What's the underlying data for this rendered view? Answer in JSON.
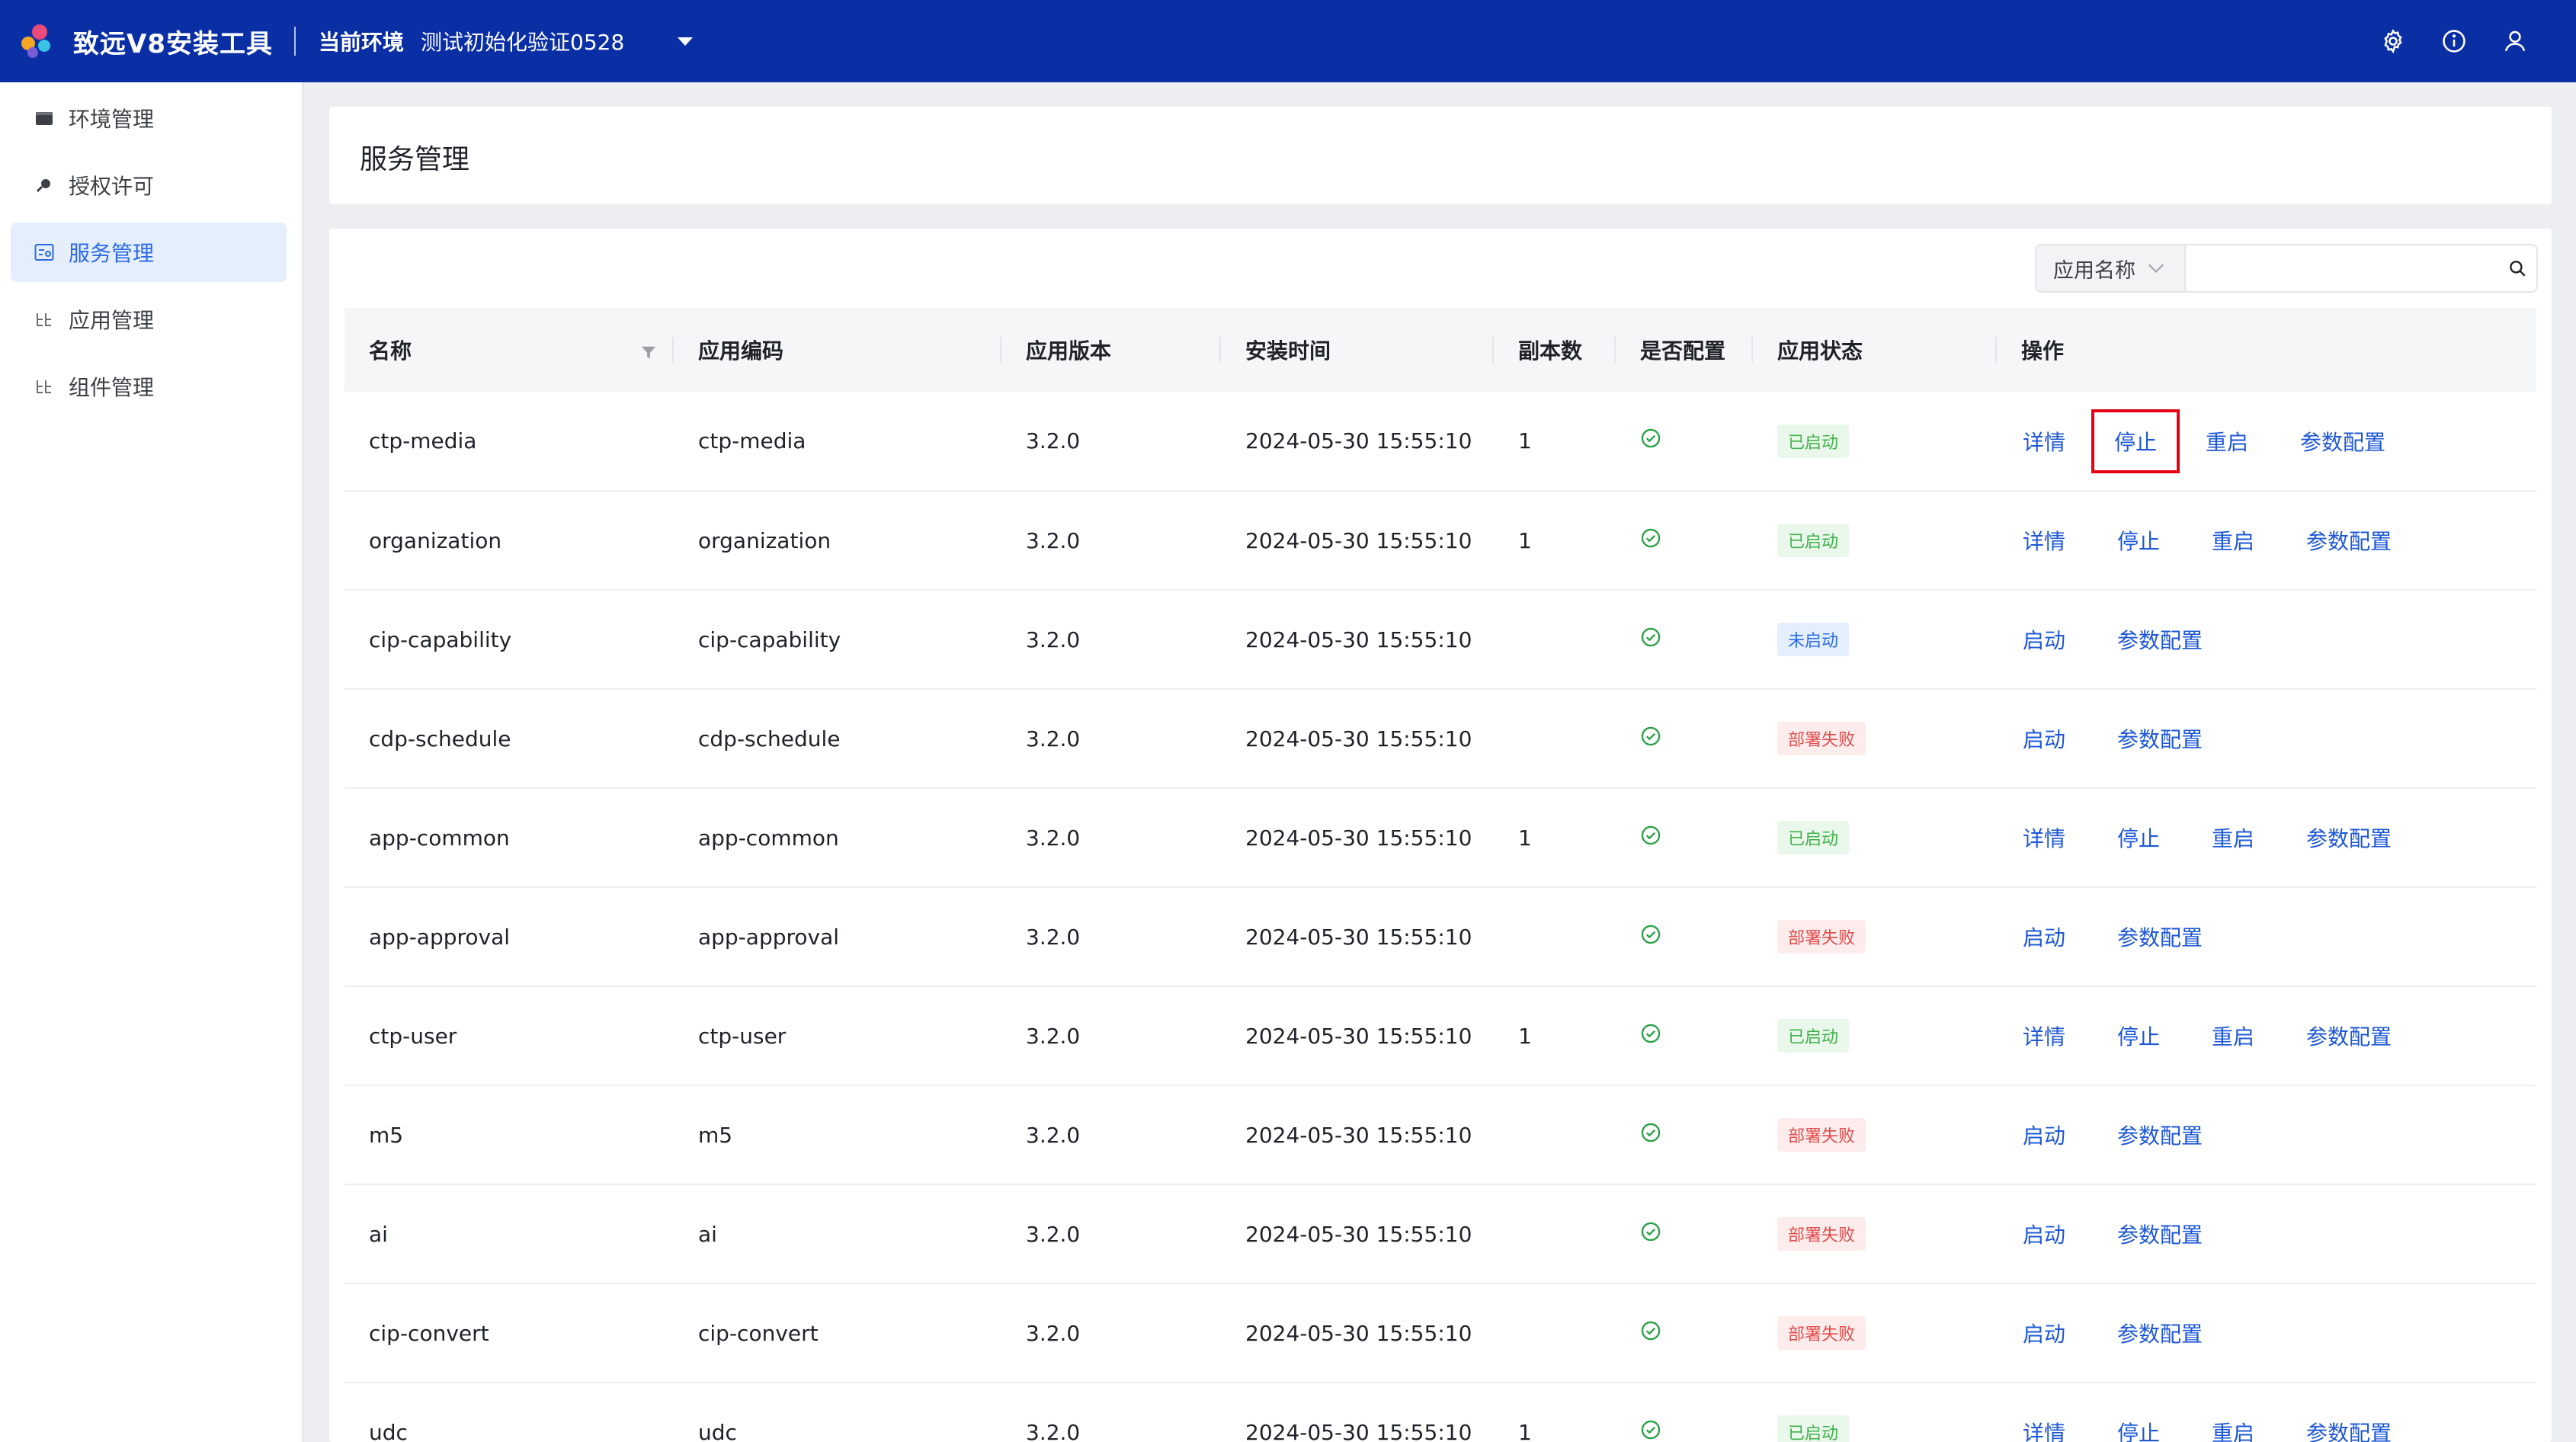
{
  "header": {
    "app_title": "致远V8安装工具",
    "env_label": "当前环境",
    "env_value": "测试初始化验证0528",
    "icons": [
      "gear-icon",
      "info-icon",
      "user-icon"
    ]
  },
  "sidebar": {
    "items": [
      {
        "label": "环境管理",
        "icon": "folder-icon",
        "active": false
      },
      {
        "label": "授权许可",
        "icon": "key-icon",
        "active": false
      },
      {
        "label": "服务管理",
        "icon": "service-icon",
        "active": true
      },
      {
        "label": "应用管理",
        "icon": "grid-icon",
        "active": false
      },
      {
        "label": "组件管理",
        "icon": "grid-icon",
        "active": false
      }
    ]
  },
  "page": {
    "title": "服务管理"
  },
  "search": {
    "select_label": "应用名称",
    "placeholder": ""
  },
  "table": {
    "columns": [
      "名称",
      "应用编码",
      "应用版本",
      "安装时间",
      "副本数",
      "是否配置",
      "应用状态",
      "操作"
    ],
    "rows": [
      {
        "name": "ctp-media",
        "code": "ctp-media",
        "version": "3.2.0",
        "time": "2024-05-30 15:55:10",
        "replicas": "1",
        "status": "已启动",
        "status_type": "started",
        "actions": [
          "详情",
          "停止",
          "重启",
          "参数配置"
        ]
      },
      {
        "name": "organization",
        "code": "organization",
        "version": "3.2.0",
        "time": "2024-05-30 15:55:10",
        "replicas": "1",
        "status": "已启动",
        "status_type": "started",
        "actions": [
          "详情",
          "停止",
          "重启",
          "参数配置"
        ]
      },
      {
        "name": "cip-capability",
        "code": "cip-capability",
        "version": "3.2.0",
        "time": "2024-05-30 15:55:10",
        "replicas": "",
        "status": "未启动",
        "status_type": "stopped",
        "actions": [
          "启动",
          "参数配置"
        ]
      },
      {
        "name": "cdp-schedule",
        "code": "cdp-schedule",
        "version": "3.2.0",
        "time": "2024-05-30 15:55:10",
        "replicas": "",
        "status": "部署失败",
        "status_type": "failed",
        "actions": [
          "启动",
          "参数配置"
        ]
      },
      {
        "name": "app-common",
        "code": "app-common",
        "version": "3.2.0",
        "time": "2024-05-30 15:55:10",
        "replicas": "1",
        "status": "已启动",
        "status_type": "started",
        "actions": [
          "详情",
          "停止",
          "重启",
          "参数配置"
        ]
      },
      {
        "name": "app-approval",
        "code": "app-approval",
        "version": "3.2.0",
        "time": "2024-05-30 15:55:10",
        "replicas": "",
        "status": "部署失败",
        "status_type": "failed",
        "actions": [
          "启动",
          "参数配置"
        ]
      },
      {
        "name": "ctp-user",
        "code": "ctp-user",
        "version": "3.2.0",
        "time": "2024-05-30 15:55:10",
        "replicas": "1",
        "status": "已启动",
        "status_type": "started",
        "actions": [
          "详情",
          "停止",
          "重启",
          "参数配置"
        ]
      },
      {
        "name": "m5",
        "code": "m5",
        "version": "3.2.0",
        "time": "2024-05-30 15:55:10",
        "replicas": "",
        "status": "部署失败",
        "status_type": "failed",
        "actions": [
          "启动",
          "参数配置"
        ]
      },
      {
        "name": "ai",
        "code": "ai",
        "version": "3.2.0",
        "time": "2024-05-30 15:55:10",
        "replicas": "",
        "status": "部署失败",
        "status_type": "failed",
        "actions": [
          "启动",
          "参数配置"
        ]
      },
      {
        "name": "cip-convert",
        "code": "cip-convert",
        "version": "3.2.0",
        "time": "2024-05-30 15:55:10",
        "replicas": "",
        "status": "部署失败",
        "status_type": "failed",
        "actions": [
          "启动",
          "参数配置"
        ]
      },
      {
        "name": "udc",
        "code": "udc",
        "version": "3.2.0",
        "time": "2024-05-30 15:55:10",
        "replicas": "1",
        "status": "已启动",
        "status_type": "started",
        "actions": [
          "详情",
          "停止",
          "重启",
          "参数配置"
        ]
      }
    ]
  },
  "colors": {
    "header_bg": "#0a2fa5",
    "link": "#1e58d6",
    "status_started": "#3fb14a",
    "status_stopped": "#2c6ae6",
    "status_failed": "#e24c4c",
    "highlight_box": "#e60012"
  }
}
